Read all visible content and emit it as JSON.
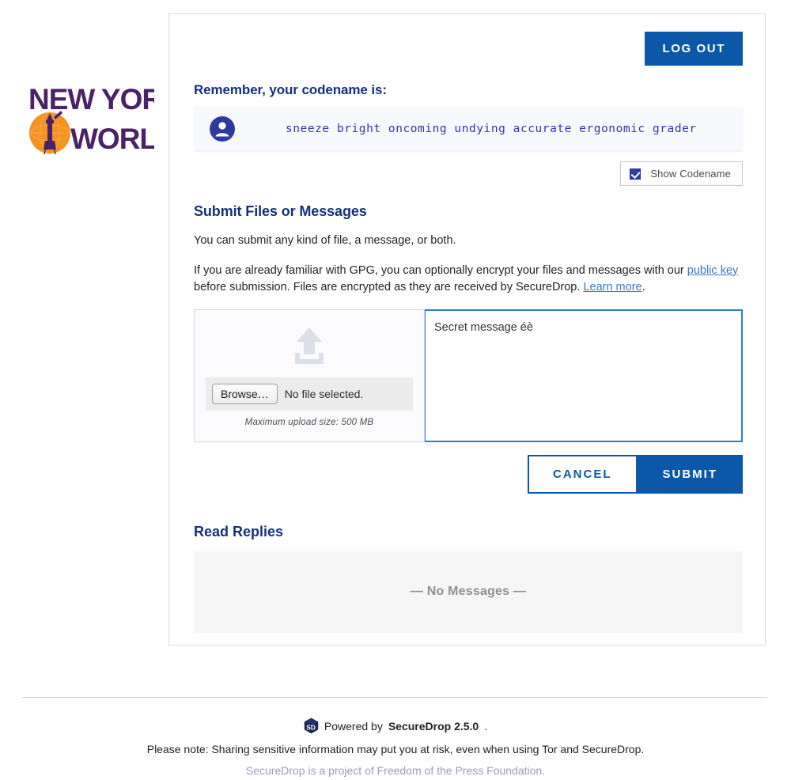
{
  "masthead": {
    "logo_line1": "NEW YORK",
    "logo_line2": "WORLD",
    "logo_icon": "globe-torch-icon",
    "logo_text_color": "#4b2267",
    "logo_globe_color": "#f59322"
  },
  "header": {
    "logout_label": "LOG OUT"
  },
  "codename": {
    "label": "Remember, your codename is:",
    "value": "sneeze bright oncoming undying accurate ergonomic grader",
    "avatar_icon": "user-avatar-icon",
    "show_codename_label": "Show Codename",
    "show_codename_checked": true
  },
  "submit": {
    "heading": "Submit Files or Messages",
    "intro": "You can submit any kind of file, a message, or both.",
    "gpg_text_before": "If you are already familiar with GPG, you can optionally encrypt your files and messages with our ",
    "gpg_link_public_key": "public key",
    "gpg_text_middle": " before submission. Files are encrypted as they are received by SecureDrop. ",
    "gpg_link_learn_more": "Learn more",
    "gpg_text_after": ".",
    "upload_icon": "upload-arrow-icon",
    "browse_label": "Browse…",
    "file_status": "No file selected.",
    "max_upload": "Maximum upload size: 500 MB",
    "message_value": "Secret message éè",
    "message_placeholder": "",
    "cancel_label": "CANCEL",
    "submit_label": "SUBMIT"
  },
  "replies": {
    "heading": "Read Replies",
    "empty_text": "— No Messages —"
  },
  "footer": {
    "cube_icon": "securedrop-cube-icon",
    "powered_prefix": "Powered by ",
    "powered_name": "SecureDrop 2.5.0",
    "powered_suffix": ".",
    "note": "Please note: Sharing sensitive information may put you at risk, even when using Tor and SecureDrop.",
    "attribution": "SecureDrop is a project of Freedom of the Press Foundation."
  },
  "colors": {
    "primary_blue": "#0b58a8",
    "heading_navy": "#15317e",
    "link_blue": "#3c78c8",
    "codename_text": "#3333b0",
    "muted_gray": "#8f8f8f"
  }
}
